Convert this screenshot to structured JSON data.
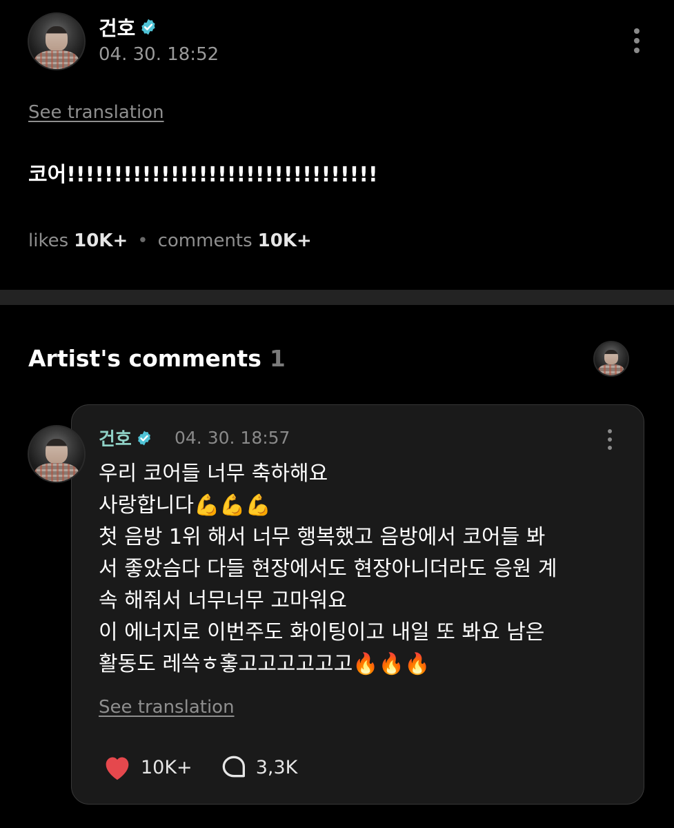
{
  "post": {
    "author": "건호",
    "timestamp": "04. 30. 18:52",
    "see_translation": "See translation",
    "body": "코어!!!!!!!!!!!!!!!!!!!!!!!!!!!!!!!!!",
    "likes_label": "likes",
    "likes_count": "10K+",
    "comments_label": "comments",
    "comments_count": "10K+"
  },
  "artist_comments": {
    "title": "Artist's comments",
    "count": "1",
    "comment": {
      "author": "건호",
      "timestamp": "04. 30. 18:57",
      "lines": [
        "우리 코어들 너무 축하해요",
        "사랑합니다💪💪💪",
        "첫 음방 1위 해서 너무 행복했고 음방에서 코어들 봐",
        "서 좋았슴다 다들 현장에서도 현장아니더라도 응원 계",
        "속 해줘서 너무너무 고마워요",
        "이 에너지로 이번주도 화이팅이고 내일 또 봐요 남은",
        "활동도 레쓱ㅎ홓고고고고고고🔥🔥🔥"
      ],
      "see_translation": "See translation",
      "likes": "10K+",
      "replies": "3,3K"
    }
  },
  "icons": {
    "verified": "verified-badge-icon",
    "more": "kebab-menu-icon",
    "like": "heart-icon",
    "reply": "comment-bubble-icon"
  },
  "colors": {
    "background": "#000000",
    "card": "#1a1a1a",
    "verified": "#4fc3d6",
    "comment_author": "#8fd1c6",
    "heart": "#e5484d"
  }
}
